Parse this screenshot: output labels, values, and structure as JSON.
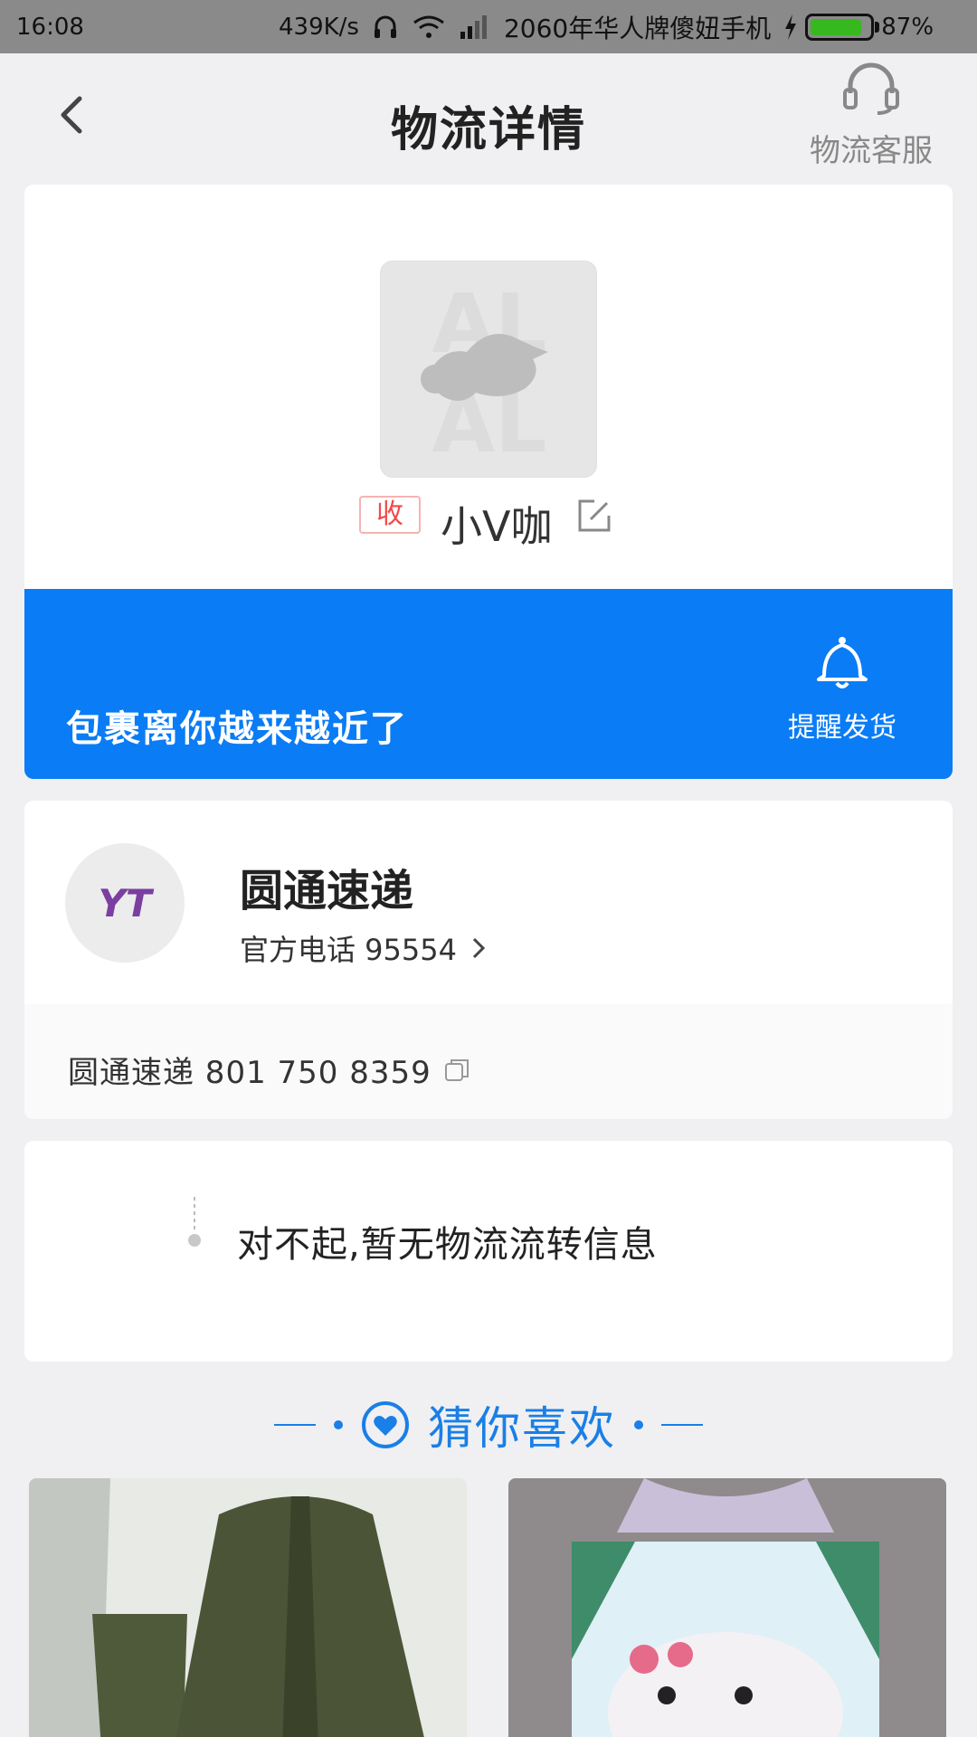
{
  "status_bar": {
    "time": "16:08",
    "net_speed": "439K/s",
    "carrier": "2060年华人牌傻妞手机",
    "battery": "87%",
    "battery_level": 0.87
  },
  "header": {
    "title": "物流详情",
    "service_label": "物流客服"
  },
  "receiver": {
    "badge": "收",
    "name": "小V咖"
  },
  "banner": {
    "message": "包裹离你越来越近了",
    "remind_label": "提醒发货"
  },
  "courier": {
    "logo_text": "YT",
    "name": "圆通速递",
    "phone_label": "官方电话 95554",
    "tracking_label": "圆通速递 801 750 8359"
  },
  "tracking": {
    "empty_message": "对不起,暂无物流流转信息"
  },
  "recommend": {
    "title": "猜你喜欢"
  },
  "colors": {
    "accent": "#0a7cf5",
    "receiver_badge": "#f04a4a"
  }
}
